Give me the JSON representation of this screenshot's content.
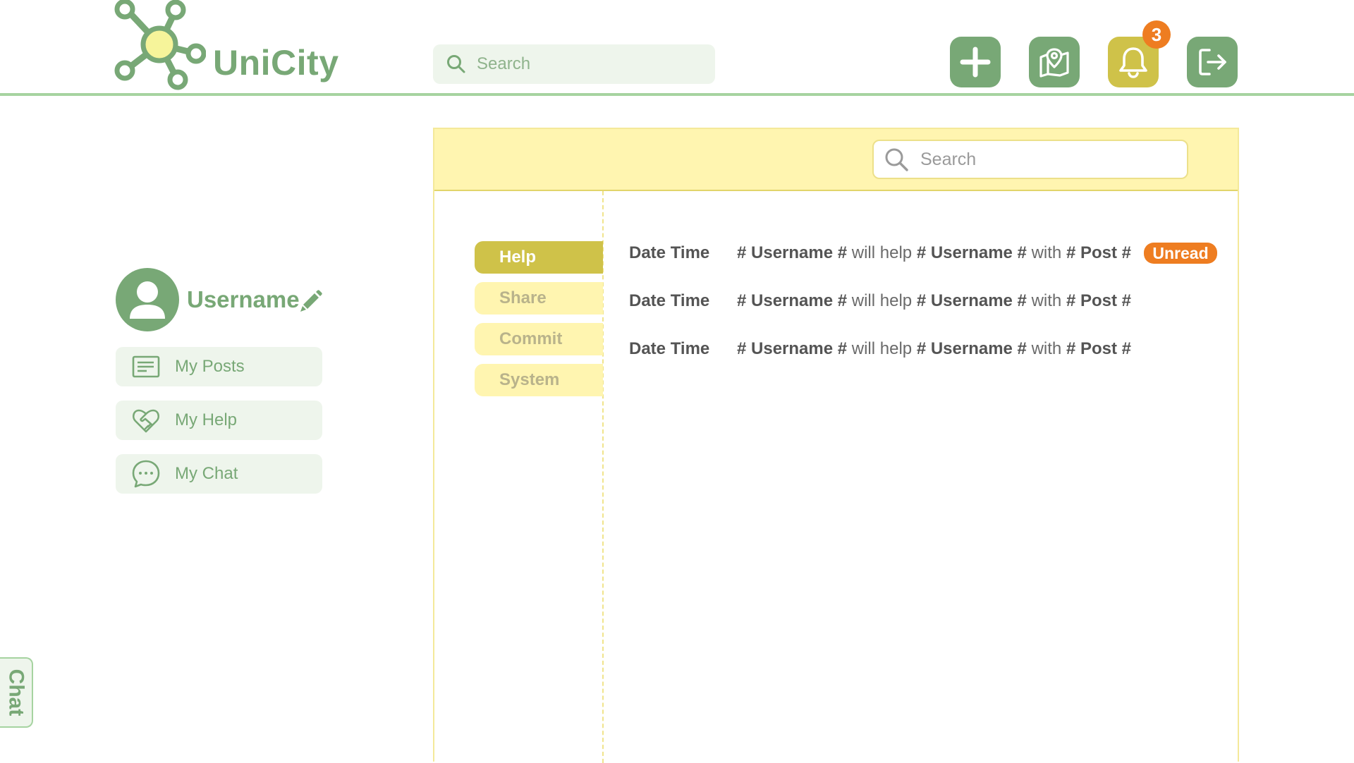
{
  "brand": {
    "name": "UniCity"
  },
  "header": {
    "search_placeholder": "Search",
    "notification_count": "3",
    "actions": [
      {
        "icon": "plus-icon"
      },
      {
        "icon": "map-pin-icon"
      },
      {
        "icon": "bell-icon"
      },
      {
        "icon": "logout-icon"
      }
    ]
  },
  "profile": {
    "username": "Username",
    "menu": [
      {
        "label": "My Posts",
        "icon": "document-lines-icon"
      },
      {
        "label": "My Help",
        "icon": "heart-handshake-icon"
      },
      {
        "label": "My Chat",
        "icon": "chat-bubble-icon"
      }
    ]
  },
  "chat_tab": {
    "label": "Chat"
  },
  "panel": {
    "search_placeholder": "Search",
    "tabs": [
      {
        "label": "Help",
        "active": true
      },
      {
        "label": "Share",
        "active": false
      },
      {
        "label": "Commit",
        "active": false
      },
      {
        "label": "System",
        "active": false
      }
    ],
    "notifications": [
      {
        "datetime": "Date Time",
        "actor": "# Username #",
        "verb": "will help",
        "target": "# Username #",
        "prep": "with",
        "post": "# Post #",
        "status": "Unread"
      },
      {
        "datetime": "Date Time",
        "actor": "# Username #",
        "verb": "will help",
        "target": "# Username #",
        "prep": "with",
        "post": "# Post #",
        "status": ""
      },
      {
        "datetime": "Date Time",
        "actor": "# Username #",
        "verb": "will help",
        "target": "# Username #",
        "prep": "with",
        "post": "# Post #",
        "status": ""
      }
    ]
  },
  "colors": {
    "primary_green": "#78a876",
    "light_green": "#eef5ec",
    "accent_yellow": "#cfc249",
    "pale_yellow": "#fff5b0",
    "badge_orange": "#ee7d21"
  }
}
